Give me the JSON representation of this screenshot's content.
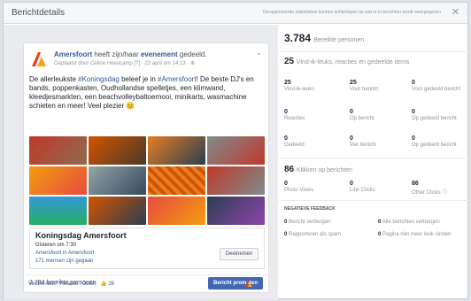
{
  "header": {
    "title": "Berichtdetails",
    "notice": "Gerapporteerde statistieken kunnen achterlopen op wat er in berichten wordt weergegeven",
    "close": "✕"
  },
  "post": {
    "page_name": "Amersfoort",
    "action_text": "heeft zijn/haar",
    "event_link": "evenement",
    "action_end": "gedeeld.",
    "sub": "Geplaatst door Celine Hoencamp [?] · 23 april om 14:13 · ⊕",
    "text_part1": "De allerleukste ",
    "hashtag1": "#Koningsdag",
    "text_part2": " beleef je in ",
    "hashtag2": "#Amersfoort",
    "text_part3": "! De beste DJ's en bands, poppenkasten, Oudhollandse spelletjes, een klimwand, kleedjesmarkten, een beachvolleybaltoernooi, minikarts, wasmachine schieten en meer! Veel plezier 😊",
    "event": {
      "title": "Koningsdag Amersfoort",
      "when": "Gisteren om 7:30",
      "where": "Amersfoort in Amersfoort",
      "going": "171 mensen zijn gegaan",
      "button": "Deelnemen"
    },
    "reach": "3.784 bereikte personen",
    "promote": "Bericht promoten",
    "actions": [
      "Vind-ik-leuk",
      "Reactie",
      "Delen",
      "👍 26"
    ]
  },
  "stats": {
    "reach_num": "3.784",
    "reach_label": "Bereikte personen",
    "interactions_num": "25",
    "interactions_label": "Vind-ik-leuks, reacties en gedeelde items",
    "likes": [
      {
        "v": "25",
        "l": "Vind-ik-leuks"
      },
      {
        "v": "25",
        "l": "Voor bericht"
      },
      {
        "v": "0",
        "l": "Voor gedeeld bericht"
      }
    ],
    "comments": [
      {
        "v": "0",
        "l": "Reacties"
      },
      {
        "v": "0",
        "l": "Op bericht"
      },
      {
        "v": "0",
        "l": "Op gedeeld bericht"
      }
    ],
    "shares": [
      {
        "v": "0",
        "l": "Gedeeld"
      },
      {
        "v": "0",
        "l": "Van bericht"
      },
      {
        "v": "0",
        "l": "Op gedeeld bericht"
      }
    ],
    "clicks_num": "86",
    "clicks_label": "Klikken op berichten",
    "clicks": [
      {
        "v": "0",
        "l": "Photo Views"
      },
      {
        "v": "0",
        "l": "Link Clicks"
      },
      {
        "v": "86",
        "l": "Other Clicks ⓘ"
      }
    ],
    "neg_title": "NEGATIEVE FEEDBACK",
    "neg": [
      {
        "v": "0",
        "l": "Bericht verbergen"
      },
      {
        "v": "0",
        "l": "Alle berichten verbergen"
      },
      {
        "v": "0",
        "l": "Rapporteren als spam"
      },
      {
        "v": "0",
        "l": "Pagina niet meer leuk vinden"
      }
    ]
  },
  "colors": {
    "brand": "#e8401c",
    "link": "#365899",
    "button": "#4267b2"
  }
}
